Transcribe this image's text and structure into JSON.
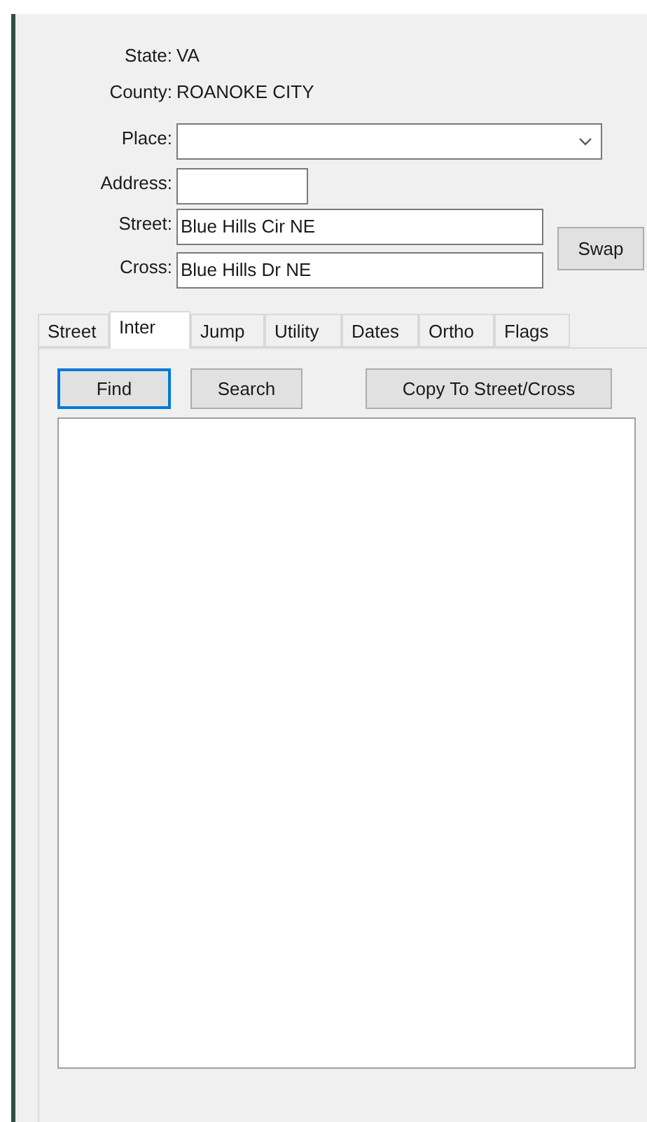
{
  "info": [
    {
      "label": "State:",
      "value": "VA"
    },
    {
      "label": "County:",
      "value": "ROANOKE CITY"
    }
  ],
  "fields": [
    {
      "kind": "combo",
      "label": "Place:"
    },
    {
      "kind": "short",
      "label": "Address:"
    },
    {
      "kind": "text",
      "label": "Street:",
      "value": "Blue Hills Cir NE"
    },
    {
      "kind": "text",
      "label": "Cross:",
      "value": "Blue Hills Dr NE"
    }
  ],
  "swap_button": "Swap",
  "tabs": [
    {
      "label": "Street",
      "selected": false
    },
    {
      "label": "Inter",
      "selected": true
    },
    {
      "label": "Jump",
      "selected": false
    },
    {
      "label": "Utility",
      "selected": false
    },
    {
      "label": "Dates",
      "selected": false
    },
    {
      "label": "Ortho",
      "selected": false
    },
    {
      "label": "Flags",
      "selected": false
    }
  ],
  "buttons": [
    {
      "label": "Find",
      "focused": true
    },
    {
      "label": "Search",
      "focused": false
    },
    {
      "label": "Copy To Street/Cross",
      "focused": false
    }
  ]
}
